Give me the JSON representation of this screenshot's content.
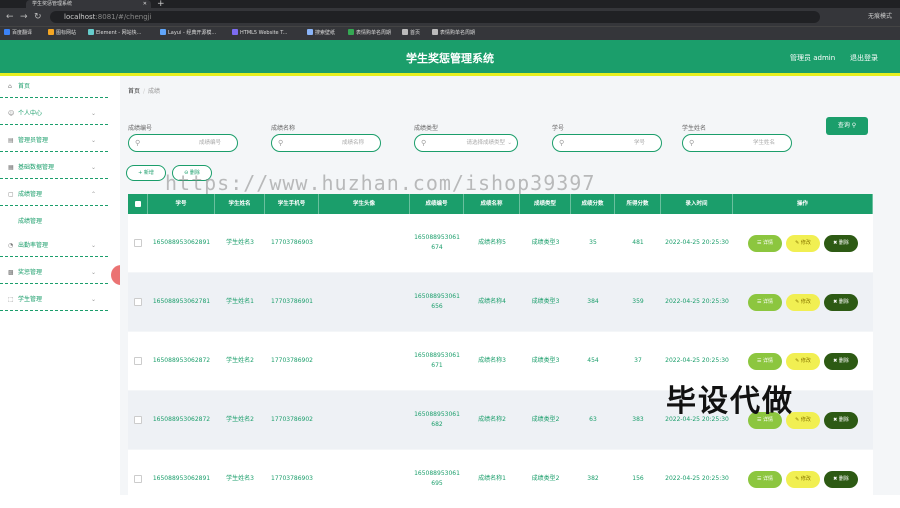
{
  "browser": {
    "tab_title": "学生奖惩管理系统",
    "url_host": "localhost",
    "url_rest": ":8081/#/chengji",
    "profile_label": "无痕模式",
    "bookmarks": [
      "百度翻译",
      "图标网站",
      "Element - 网站快...",
      "Layui - 经典开源模...",
      "HTML5 Website T...",
      "搜索壁纸",
      "表情购单名周期",
      "首页",
      "表情购单名周期"
    ]
  },
  "header": {
    "title": "学生奖惩管理系统",
    "user_label": "管理员 admin",
    "logout_label": "退出登录"
  },
  "sidebar": {
    "items": [
      {
        "label": "首页",
        "icon": "home-icon"
      },
      {
        "label": "个人中心",
        "icon": "user-icon"
      },
      {
        "label": "管理员管理",
        "icon": "admin-icon"
      },
      {
        "label": "基础数据管理",
        "icon": "data-icon"
      },
      {
        "label": "成绩管理",
        "icon": "score-icon"
      },
      {
        "label": "出勤率管理",
        "icon": "attendance-icon"
      },
      {
        "label": "奖惩管理",
        "icon": "reward-icon"
      },
      {
        "label": "学生管理",
        "icon": "student-icon"
      }
    ],
    "active_sub": "成绩管理"
  },
  "breadcrumb": {
    "home": "首页",
    "current": "成绩"
  },
  "watermark": "https://www.huzhan.com/ishop39397",
  "filters": [
    {
      "label": "成绩编号",
      "placeholder": "成绩编号"
    },
    {
      "label": "成绩名称",
      "placeholder": "成绩名称"
    },
    {
      "label": "成绩类型",
      "placeholder": "请选择成绩类型"
    },
    {
      "label": "学号",
      "placeholder": "学号"
    },
    {
      "label": "学生姓名",
      "placeholder": "学生姓名"
    }
  ],
  "buttons": {
    "search": "查询",
    "add": "新增",
    "delete": "删除"
  },
  "table": {
    "headers": [
      "学号",
      "学生姓名",
      "学生手机号",
      "学生头像",
      "成绩编号",
      "成绩名称",
      "成绩类型",
      "成绩分数",
      "所得分数",
      "录入时间",
      "操作"
    ],
    "action_labels": {
      "detail": "详情",
      "edit": "修改",
      "delete": "删除"
    },
    "rows": [
      {
        "xuehao": "165088953062891",
        "name": "学生姓名3",
        "phone": "17703786903",
        "code": "165088953061674",
        "cname": "成绩名称5",
        "ctype": "成绩类型3",
        "score": "35",
        "got": "481",
        "time": "2022-04-25 20:25:30"
      },
      {
        "xuehao": "165088953062781",
        "name": "学生姓名1",
        "phone": "17703786901",
        "code": "165088953061656",
        "cname": "成绩名称4",
        "ctype": "成绩类型3",
        "score": "384",
        "got": "359",
        "time": "2022-04-25 20:25:30"
      },
      {
        "xuehao": "165088953062872",
        "name": "学生姓名2",
        "phone": "17703786902",
        "code": "165088953061671",
        "cname": "成绩名称3",
        "ctype": "成绩类型3",
        "score": "454",
        "got": "37",
        "time": "2022-04-25 20:25:30"
      },
      {
        "xuehao": "165088953062872",
        "name": "学生姓名2",
        "phone": "17703786902",
        "code": "165088953061682",
        "cname": "成绩名称2",
        "ctype": "成绩类型2",
        "score": "63",
        "got": "383",
        "time": "2022-04-25 20:25:30"
      },
      {
        "xuehao": "165088953062891",
        "name": "学生姓名3",
        "phone": "17703786903",
        "code": "165088953061695",
        "cname": "成绩名称1",
        "ctype": "成绩类型2",
        "score": "382",
        "got": "156",
        "time": "2022-04-25 20:25:30"
      }
    ]
  },
  "overlay": "毕设代做",
  "colors": {
    "primary": "#1b9e6b",
    "accent": "#e6ef1f",
    "detail": "#8cc63f",
    "edit": "#f1ef52",
    "delete": "#2d5a14"
  }
}
